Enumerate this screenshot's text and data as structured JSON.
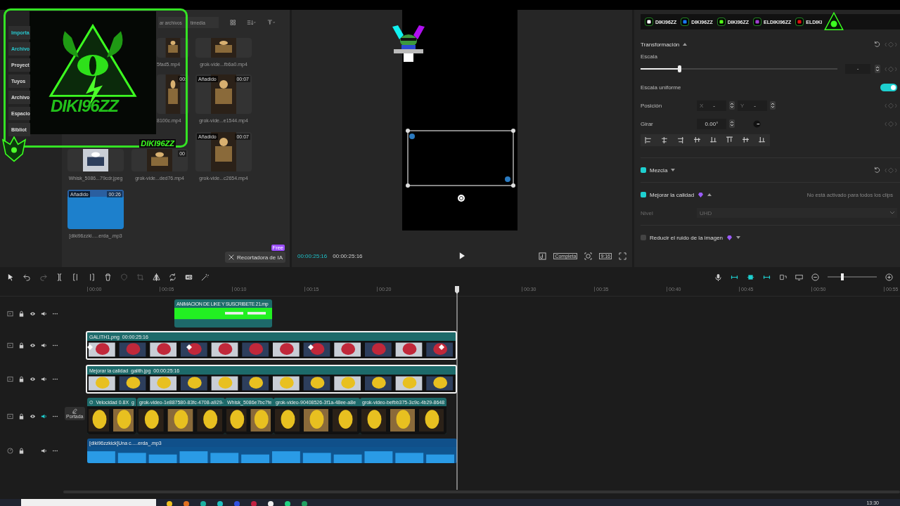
{
  "overlay": {
    "large_name": "DIKI96ZZ",
    "small_name": "DIKI96ZZ"
  },
  "media_nav": [
    {
      "label": "Importa",
      "selected": true
    },
    {
      "label": "Archivo",
      "selected": true
    },
    {
      "label": "Proyect",
      "selected": false
    },
    {
      "label": "Tuyos",
      "selected": false
    },
    {
      "label": "Archivo",
      "selected": false
    },
    {
      "label": "Espacio",
      "selected": false
    },
    {
      "label": "Bibliot",
      "selected": false
    }
  ],
  "media_search": [
    "ar archivos",
    "timedia"
  ],
  "media_rows": [
    [
      null,
      {
        "name": "5fad5.mp4",
        "kind": "video"
      },
      {
        "name": "grok-vide...fb6a0.mp4",
        "kind": "video"
      }
    ],
    [
      null,
      {
        "name": "8100c.mp4",
        "kind": "video",
        "duration": "00:"
      },
      {
        "name": "grok-vide...e1544.mp4",
        "kind": "video",
        "added": "Añadido",
        "duration": "00:07"
      }
    ],
    [
      {
        "name": "Whisk_5086...79cdr.jpeg"
      },
      {
        "name": "grok-vide...ded76.mp4",
        "kind": "video",
        "duration": "00"
      },
      {
        "name": "grok-vide...c2654.mp4",
        "kind": "video",
        "added": "Añadido",
        "duration": "00:07"
      }
    ],
    [
      {
        "name": "[diki96zzki.....erda_.mp3",
        "kind": "audio",
        "added": "Añadido",
        "duration": "00:26"
      }
    ]
  ],
  "ai_cutout": {
    "label": "Recortadora de IA",
    "badge": "Free"
  },
  "preview": {
    "current": "00:00:25:16",
    "total": "00:00:25:16",
    "ratio_mode": "Completa",
    "aspect": "9:16"
  },
  "socials": [
    {
      "kind": "tiktok",
      "handle": "DIKI96ZZ"
    },
    {
      "kind": "facebook",
      "handle": "DIKI96ZZ"
    },
    {
      "kind": "kick",
      "handle": "DIKI96ZZ"
    },
    {
      "kind": "instagram",
      "handle": "ELDIKI96ZZ"
    },
    {
      "kind": "youtube",
      "handle": "ELDIKI"
    }
  ],
  "properties": {
    "title": "Transformación",
    "scale": {
      "label": "Escala",
      "level": 0.2,
      "value": "-"
    },
    "uniform": {
      "label": "Escala uniforme",
      "on": true
    },
    "position": {
      "label": "Posición",
      "x_label": "X",
      "x": "-",
      "y_label": "Y",
      "y": "-"
    },
    "rotate": {
      "label": "Girar",
      "value": "0.00°"
    }
  },
  "blend": {
    "label": "Mezcla",
    "checked": true
  },
  "enhance": {
    "label": "Mejorar la calidad",
    "checked": true,
    "note": "No está activado para todos los clips",
    "level_label": "Nivel",
    "level_value": "UHD"
  },
  "denoise": {
    "label": "Reducir el ruido de la imagen",
    "checked": false
  },
  "timeline_zoom": {
    "level": 0.3
  },
  "ruler": [
    "00:00",
    "00:05",
    "00:10",
    "00:15",
    "00:20",
    "00:30",
    "00:35",
    "00:40",
    "00:45",
    "00:50",
    "00:55"
  ],
  "tracks": [
    {
      "kind": "video",
      "clips": [
        {
          "label": "ANIMACION DE LIKE Y SUSCRIBETE 21.mp",
          "kind": "green",
          "selected": false
        }
      ]
    },
    {
      "kind": "video",
      "clips": [
        {
          "label": "GALITH1.png",
          "duration": "00:00:25:16",
          "selected": true
        }
      ]
    },
    {
      "kind": "video",
      "clips": [
        {
          "tag": "Mejorar la calidad",
          "label": "galith.jpg",
          "duration": "00:00:25:16",
          "selected": true
        }
      ]
    },
    {
      "kind": "video",
      "cover": "Portada",
      "clips": [
        {
          "speed": "Velocidad 0.8X",
          "label": "g",
          "kind": "video",
          "selected": false
        },
        {
          "label": "grok-video-1e887580-83fc-4708-a929-",
          "kind": "video",
          "selected": false
        },
        {
          "label": "Whisk_5086e7bc7fe",
          "kind": "video",
          "selected": false
        },
        {
          "label": "grok-video-90408526-3f1a-48ee-a8e",
          "kind": "video",
          "selected": false
        },
        {
          "label": "grok-video-befbb375-3c9c-4b29-8648",
          "kind": "video",
          "selected": false
        }
      ]
    },
    {
      "kind": "audio",
      "clips": [
        {
          "label": "[diki96zzkick]Una c.....erda_.mp3",
          "kind": "audio",
          "selected": false
        }
      ]
    }
  ],
  "taskbar": {
    "time": "13:30"
  }
}
